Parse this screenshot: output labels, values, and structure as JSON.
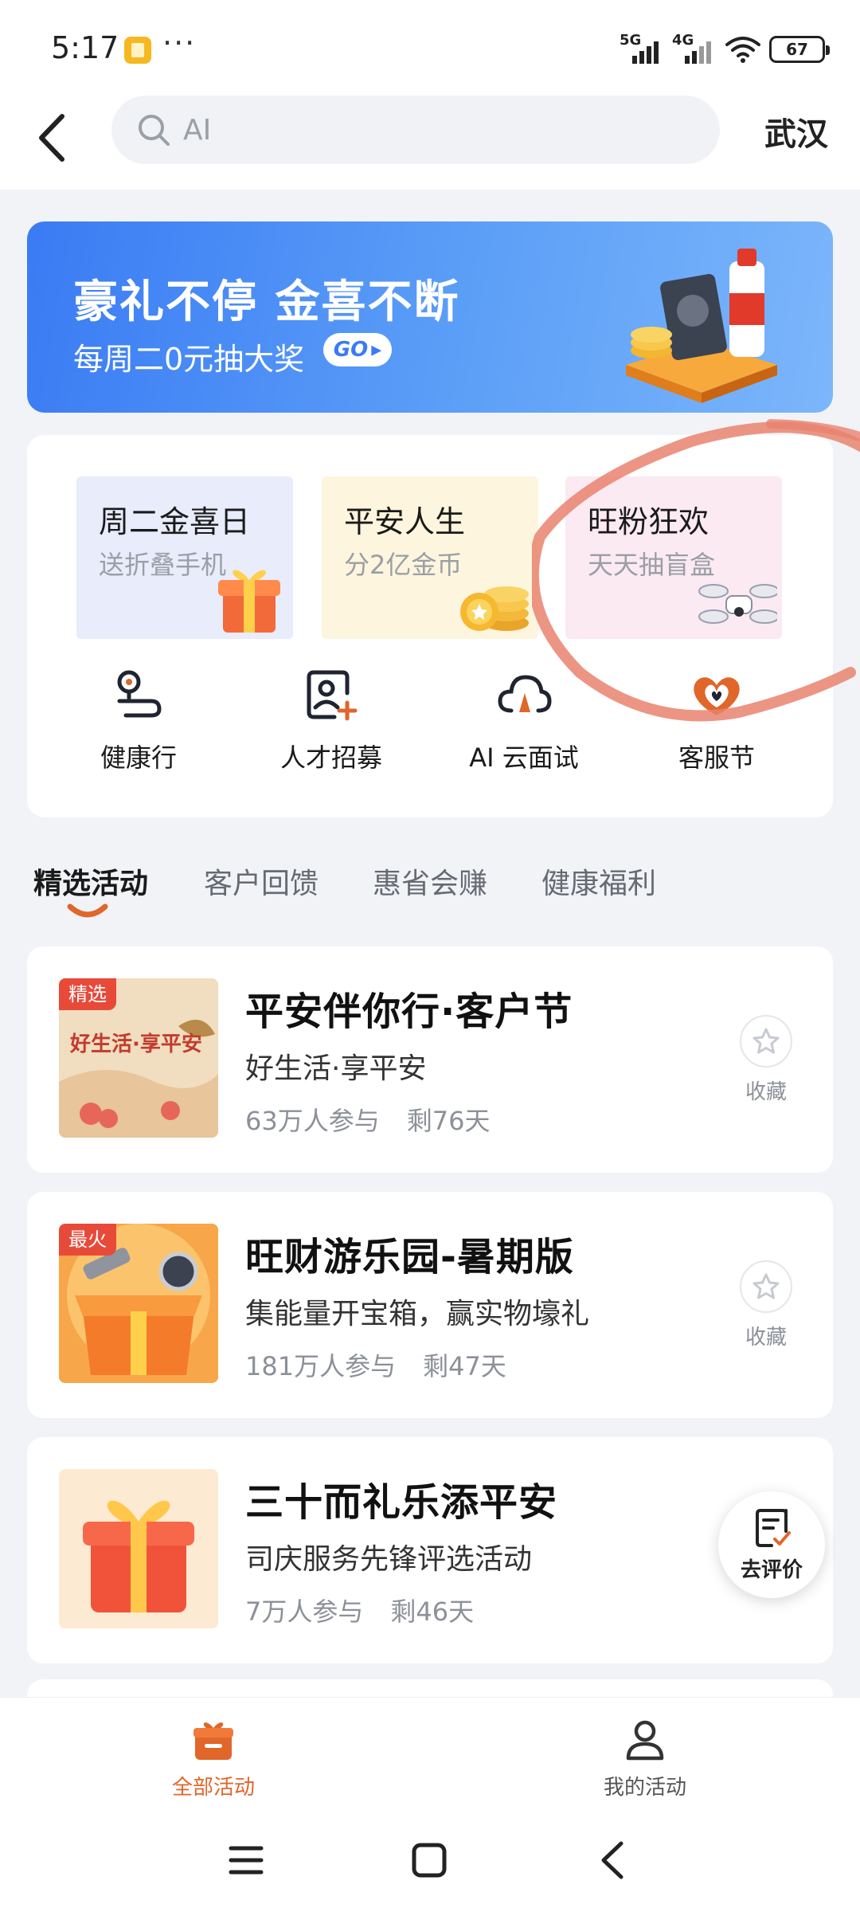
{
  "status_bar": {
    "time": "5:17",
    "more": "···",
    "network_1": "5G",
    "network_2": "4G",
    "battery": "67"
  },
  "search": {
    "placeholder": "AI",
    "value": "",
    "city": "武汉"
  },
  "banner": {
    "title": "豪礼不停 金喜不断",
    "subtitle": "每周二0元抽大奖",
    "go_label": "GO"
  },
  "feature_tiles": [
    {
      "title": "周二金喜日",
      "subtitle": "送折叠手机",
      "icon": "gift-box-icon"
    },
    {
      "title": "平安人生",
      "subtitle": "分2亿金币",
      "icon": "gold-coins-icon"
    },
    {
      "title": "旺粉狂欢",
      "subtitle": "天天抽盲盒",
      "icon": "drone-icon"
    }
  ],
  "quick_actions": [
    {
      "label": "健康行",
      "icon": "route-pin-icon"
    },
    {
      "label": "人才招募",
      "icon": "add-person-icon"
    },
    {
      "label": "AI 云面试",
      "icon": "cloud-icon"
    },
    {
      "label": "客服节",
      "icon": "heart-logo-icon"
    }
  ],
  "tabs": [
    {
      "label": "精选活动",
      "active": true
    },
    {
      "label": "客户回馈",
      "active": false
    },
    {
      "label": "惠省会赚",
      "active": false
    },
    {
      "label": "健康福利",
      "active": false
    }
  ],
  "activities": [
    {
      "badge": "精选",
      "title": "平安伴你行·客户节",
      "desc": "好生活·享平安",
      "participants": "63万人参与",
      "remaining": "剩76天",
      "fav_label": "收藏",
      "thumb_text": "好生活·享平安"
    },
    {
      "badge": "最火",
      "title": "旺财游乐园-暑期版",
      "desc": "集能量开宝箱，赢实物壕礼",
      "participants": "181万人参与",
      "remaining": "剩47天",
      "fav_label": "收藏"
    },
    {
      "badge": "",
      "title": "三十而礼乐添平安",
      "desc": "司庆服务先锋评选活动",
      "participants": "7万人参与",
      "remaining": "剩46天",
      "fav_label": ""
    }
  ],
  "float_button": {
    "label": "去评价"
  },
  "bottom_nav": [
    {
      "label": "全部活动",
      "active": true,
      "icon": "gift-icon"
    },
    {
      "label": "我的活动",
      "active": false,
      "icon": "person-icon"
    }
  ],
  "colors": {
    "accent": "#e0662a",
    "banner_blue": "#3a7bf4",
    "annotation_circle": "#e9826f",
    "badge_red": "#e84a3a"
  }
}
